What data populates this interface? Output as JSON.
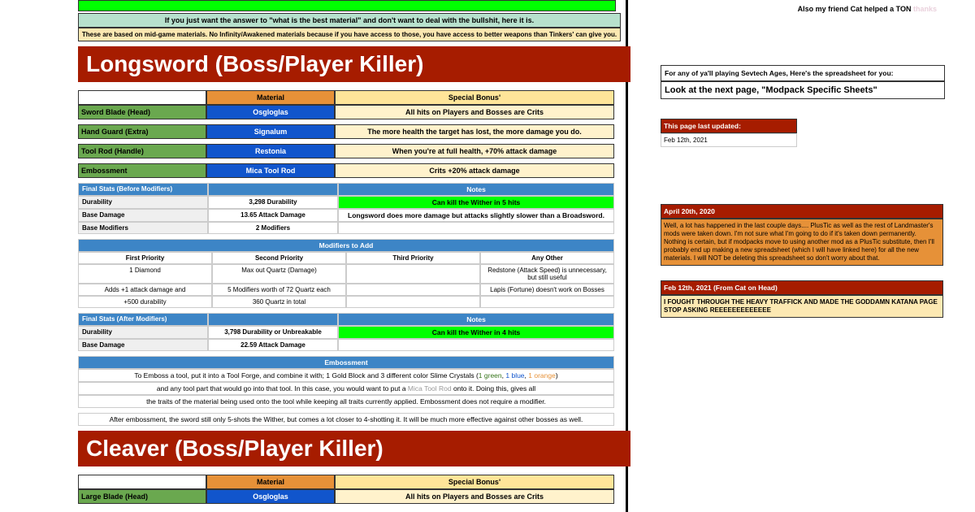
{
  "top": {
    "note1": "If you just want the answer to \"what is the best material\" and don't want to deal with the bullshit, here it is.",
    "note2": "These are based on mid-game materials. No Infinity/Awakened materials because if you have access to those, you have access to better weapons than Tinkers' can give you."
  },
  "longsword": {
    "title": "Longsword (Boss/Player Killer)",
    "hdr_mat": "Material",
    "hdr_bonus": "Special Bonus'",
    "parts": [
      {
        "name": "Sword Blade (Head)",
        "mat": "Osgloglas",
        "bonus": "All hits on Players and Bosses are Crits"
      },
      {
        "name": "Hand Guard (Extra)",
        "mat": "Signalum",
        "bonus": "The more health the target has lost, the more damage you do."
      },
      {
        "name": "Tool Rod (Handle)",
        "mat": "Restonia",
        "bonus": "When you're at full health, +70% attack damage"
      },
      {
        "name": "Embossment",
        "mat": "Mica Tool Rod",
        "bonus": "Crits +20% attack damage"
      }
    ],
    "stats_before_hdr": "Final Stats (Before Modifiers)",
    "notes_hdr": "Notes",
    "stats_before": [
      {
        "k": "Durability",
        "v": "3,298 Durability"
      },
      {
        "k": "Base Damage",
        "v": "13.65 Attack Damage"
      },
      {
        "k": "Base Modifiers",
        "v": "2 Modifiers"
      }
    ],
    "note_green_1": "Can kill the Wither in 5 hits",
    "note_white_1": "Longsword does more damage but attacks slightly slower than a Broadsword.",
    "mods_hdr": "Modifiers to Add",
    "mods_cols": [
      "First Priority",
      "Second Priority",
      "Third Priority",
      "Any Other"
    ],
    "mods_r1": [
      "1 Diamond",
      "Max out Quartz (Damage)",
      "",
      "Redstone (Attack Speed) is unnecessary, but still useful"
    ],
    "mods_r2": [
      "Adds +1 attack damage and",
      "5 Modifiers worth of 72 Quartz each",
      "",
      "Lapis (Fortune) doesn't work on Bosses"
    ],
    "mods_r3": [
      "+500 durability",
      "360 Quartz in total",
      "",
      ""
    ],
    "stats_after_hdr": "Final Stats (After Modifiers)",
    "stats_after": [
      {
        "k": "Durability",
        "v": "3,798 Durability or Unbreakable"
      },
      {
        "k": "Base Damage",
        "v": "22.59 Attack Damage"
      }
    ],
    "note_green_2": "Can kill the Wither in 4 hits",
    "emboss_hdr": "Embossment",
    "emboss_1a": "To Emboss a tool, put it into a Tool Forge, and combine it with; 1 Gold Block and 3 different color Slime Crystals (",
    "emboss_1b": "1 green",
    "emboss_1c": ", ",
    "emboss_1d": "1 blue",
    "emboss_1e": ", ",
    "emboss_1f": "1 orange",
    "emboss_1g": ")",
    "emboss_2a": "and any tool part that would go into that tool. In this case, you would want to put a ",
    "emboss_2b": "Mica Tool Rod",
    "emboss_2c": " onto it. Doing this, gives all",
    "emboss_3": "the traits of the material being used onto the tool while keeping all traits currently applied. Embossment does not require a modifier.",
    "emboss_4": "After embossment, the sword still only 5-shots the Wither, but comes a lot closer to 4-shotting it. It will be much more effective against other bosses as well."
  },
  "cleaver": {
    "title": "Cleaver (Boss/Player Killer)",
    "hdr_mat": "Material",
    "hdr_bonus": "Special Bonus'",
    "part1": {
      "name": "Large Blade (Head)",
      "mat": "Osgloglas",
      "bonus": "All hits on Players and Bosses are Crits"
    }
  },
  "side": {
    "friend_a": "Also my friend Cat helped a TON    ",
    "friend_b": "thanks",
    "sevtech_1": "For any of ya'll playing Sevtech Ages, Here's the spreadsheet for you:",
    "sevtech_2": "Look at the next page, \"Modpack Specific Sheets\"",
    "updated_hdr": "This page last updated:",
    "updated_date": "Feb 12th, 2021",
    "note1_hdr": "April 20th, 2020",
    "note1_body": "Well, a lot has happened in the last couple days.... PlusTic as well as the rest of Landmaster's mods were taken down. I'm not sure what I'm going to do if it's taken down permanently. Nothing is certain, but if modpacks move to using another mod as a PlusTic substitute, then I'll probably end up making a new spreadsheet (which I will have linked here) for all the new materials. I will NOT be deleting this spreadsheet so don't worry about that.",
    "note2_hdr": "Feb 12th, 2021 (From Cat on Head)",
    "note2_body": "I FOUGHT THROUGH THE HEAVY TRAFFICK AND MADE THE GODDAMN KATANA PAGE STOP ASKING REEEEEEEEEEEEE"
  }
}
